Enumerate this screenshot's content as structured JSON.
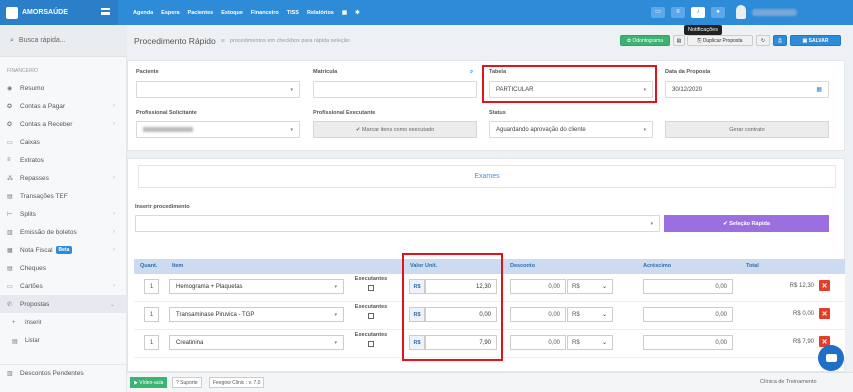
{
  "app": {
    "logo_text": "AMORSAÚDE"
  },
  "topnav": [
    "Agenda",
    "Espera",
    "Pacientes",
    "Estoque",
    "Financeiro",
    "TISS",
    "Relatórios"
  ],
  "tooltip": "Notificações",
  "sidebar": {
    "search_placeholder": "Busca rápida...",
    "section": "FINANCEIRO",
    "items": [
      {
        "icon": "◉",
        "label": "Resumo"
      },
      {
        "icon": "✪",
        "label": "Contas a Pagar"
      },
      {
        "icon": "✪",
        "label": "Contas a Receber"
      },
      {
        "icon": "▭",
        "label": "Caixas"
      },
      {
        "icon": "≡",
        "label": "Extratos"
      },
      {
        "icon": "⁂",
        "label": "Repasses"
      },
      {
        "icon": "▤",
        "label": "Transações TEF"
      },
      {
        "icon": "⊢",
        "label": "Splits"
      },
      {
        "icon": "▥",
        "label": "Emissão de boletos"
      },
      {
        "icon": "▦",
        "label": "Nota Fiscal",
        "badge": "Beta"
      },
      {
        "icon": "▤",
        "label": "Cheques"
      },
      {
        "icon": "▭",
        "label": "Cartões"
      },
      {
        "icon": "✆",
        "label": "Propostas"
      },
      {
        "icon": "+",
        "label": "Inserir"
      },
      {
        "icon": "▤",
        "label": "Listar"
      },
      {
        "icon": "▥",
        "label": "Descontos Pendentes"
      }
    ]
  },
  "header": {
    "title": "Procedimento Rápido",
    "subtitle": "procedimentos em checkbox para rápida seleção",
    "btn_odontograma": "Odontograma",
    "btn_duplicar": "Duplicar Proposta",
    "btn_salvar": "SALVAR"
  },
  "form": {
    "paciente_label": "Paciente",
    "matricula_label": "Matrícula",
    "tabela_label": "Tabela",
    "tabela_value": "PARTICULAR",
    "data_label": "Data da Proposta",
    "data_value": "30/12/2020",
    "prof_sol_label": "Profissional Solicitante",
    "prof_exec_label": "Profissional Executante",
    "marcar_btn": "Marcar itens como executado",
    "status_label": "Status",
    "status_value": "Aguardando aprovação do cliente",
    "gerar_btn": "Gerar contrato"
  },
  "exames": {
    "title": "Exames",
    "inserir_label": "Inserir procedimento",
    "selecao_btn": "Seleção Rápida",
    "columns": [
      "Quant.",
      "Item",
      "Valor Unit.",
      "Desconto",
      "Acréscimo",
      "Total"
    ],
    "exec_label": "Executantes",
    "rows": [
      {
        "qty": "1",
        "item": "Hemograma + Plaquetas",
        "cur": "R$",
        "valor": "12,30",
        "desconto": "0,00",
        "tipo": "R$",
        "acrescimo": "0,00",
        "total": "R$ 12,30"
      },
      {
        "qty": "1",
        "item": "Transaminase Piruvica - TGP",
        "cur": "R$",
        "valor": "0,00",
        "desconto": "0,00",
        "tipo": "R$",
        "acrescimo": "0,00",
        "total": "R$ 0,00"
      },
      {
        "qty": "1",
        "item": "Creatinina",
        "cur": "R$",
        "valor": "7,90",
        "desconto": "0,00",
        "tipo": "R$",
        "acrescimo": "0,00",
        "total": "R$ 7,90"
      }
    ]
  },
  "footer": {
    "video": "Vídeo-aula",
    "suporte": "Suporte",
    "version": "Feegow Clinic : v. 7.0",
    "right": "Clínica de Treinamento"
  }
}
